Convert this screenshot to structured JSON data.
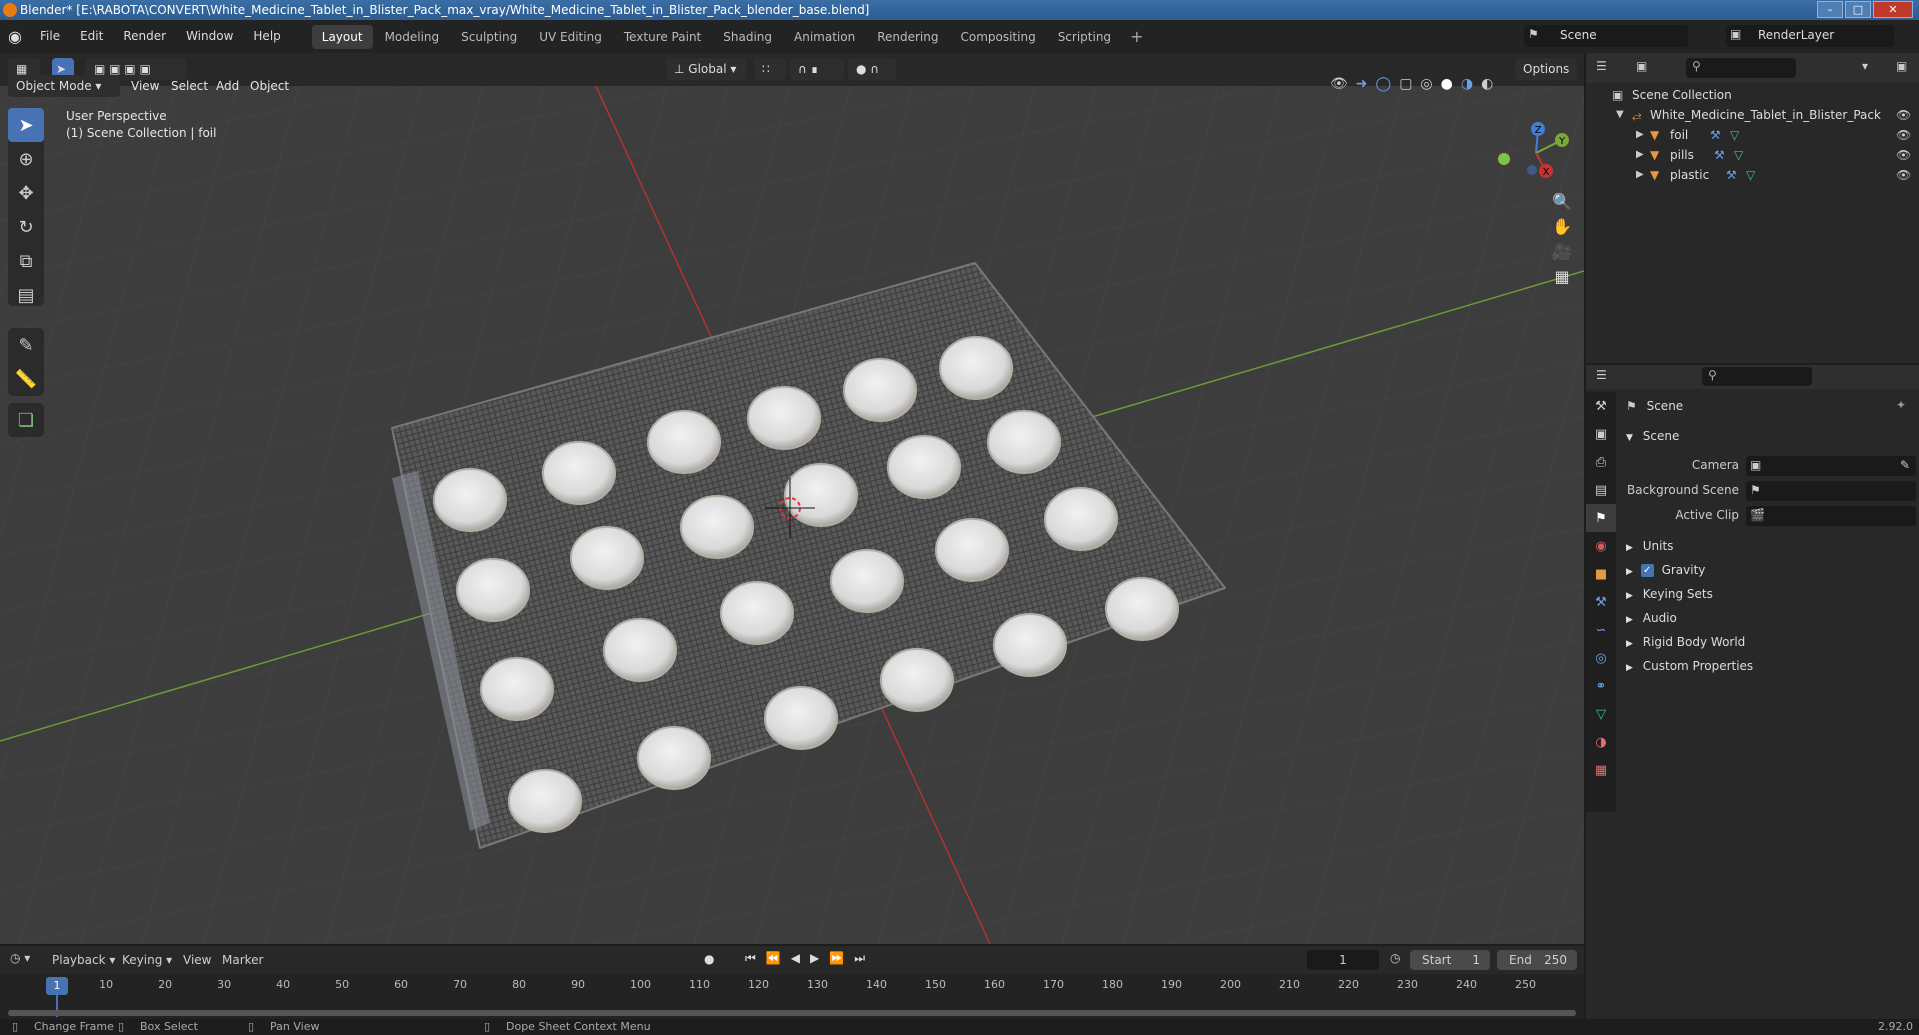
{
  "window": {
    "title": "Blender* [E:\\RABOTA\\CONVERT\\White_Medicine_Tablet_in_Blister_Pack_max_vray/White_Medicine_Tablet_in_Blister_Pack_blender_base.blend]"
  },
  "menu": [
    "File",
    "Edit",
    "Render",
    "Window",
    "Help"
  ],
  "workspaces": [
    "Layout",
    "Modeling",
    "Sculpting",
    "UV Editing",
    "Texture Paint",
    "Shading",
    "Animation",
    "Rendering",
    "Compositing",
    "Scripting"
  ],
  "active_workspace": "Layout",
  "scene_selector": "Scene",
  "render_layer": "RenderLayer",
  "viewport": {
    "mode": "Object Mode",
    "header_menu": [
      "View",
      "Select",
      "Add",
      "Object"
    ],
    "transform_orientation": "Global",
    "options_label": "Options",
    "overlay_line1": "User Perspective",
    "overlay_line2": "(1) Scene Collection | foil",
    "gizmo_axes": [
      "Z",
      "Y",
      "X"
    ]
  },
  "outliner": {
    "root": "Scene Collection",
    "collection": "White_Medicine_Tablet_in_Blister_Pack",
    "objects": [
      "foil",
      "pills",
      "plastic"
    ]
  },
  "properties": {
    "header_title": "Scene",
    "panel_title": "Scene",
    "fields": [
      {
        "label": "Camera"
      },
      {
        "label": "Background Scene"
      },
      {
        "label": "Active Clip"
      }
    ],
    "sections": [
      "Units",
      "Gravity",
      "Keying Sets",
      "Audio",
      "Rigid Body World",
      "Custom Properties"
    ],
    "gravity_checked": true
  },
  "timeline": {
    "menu": [
      "Playback",
      "Keying",
      "View",
      "Marker"
    ],
    "current_frame": "1",
    "start_label": "Start",
    "start": "1",
    "end_label": "End",
    "end": "250",
    "ticks": [
      "1",
      "10",
      "20",
      "30",
      "40",
      "50",
      "60",
      "70",
      "80",
      "90",
      "100",
      "110",
      "120",
      "130",
      "140",
      "150",
      "160",
      "170",
      "180",
      "190",
      "200",
      "210",
      "220",
      "230",
      "240",
      "250"
    ]
  },
  "status": {
    "items": [
      "Change Frame",
      "Box Select",
      "Pan View",
      "Dope Sheet Context Menu"
    ],
    "version": "2.92.0"
  },
  "colors": {
    "accent": "#4772b3",
    "x_axis": "#c83232",
    "y_axis": "#7aa83a",
    "z_axis": "#3f7fd6"
  }
}
